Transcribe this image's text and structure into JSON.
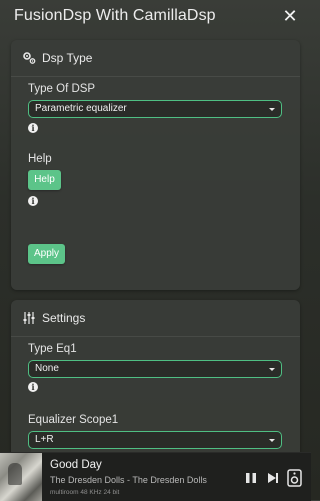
{
  "window": {
    "title": "FusionDsp With CamillaDsp",
    "close_icon": "close-icon"
  },
  "dsp_panel": {
    "header": "Dsp Type",
    "icon": "gears-icon",
    "type_label": "Type Of DSP",
    "type_value": "Parametric equalizer",
    "help_label": "Help",
    "help_button": "Help",
    "apply_button": "Apply",
    "accent_color": "#5cc489"
  },
  "settings_panel": {
    "header": "Settings",
    "icon": "sliders-icon",
    "eq_label": "Type Eq1",
    "eq_value": "None",
    "scope_label": "Equalizer Scope1",
    "scope_value": "L+R"
  },
  "player": {
    "title": "Good Day",
    "artist": "The Dresden Dolls - The Dresden Dolls",
    "quality": "multiroom 48 KHz 24 bit",
    "controls": [
      "pause-icon",
      "next-icon",
      "speaker-icon"
    ]
  }
}
